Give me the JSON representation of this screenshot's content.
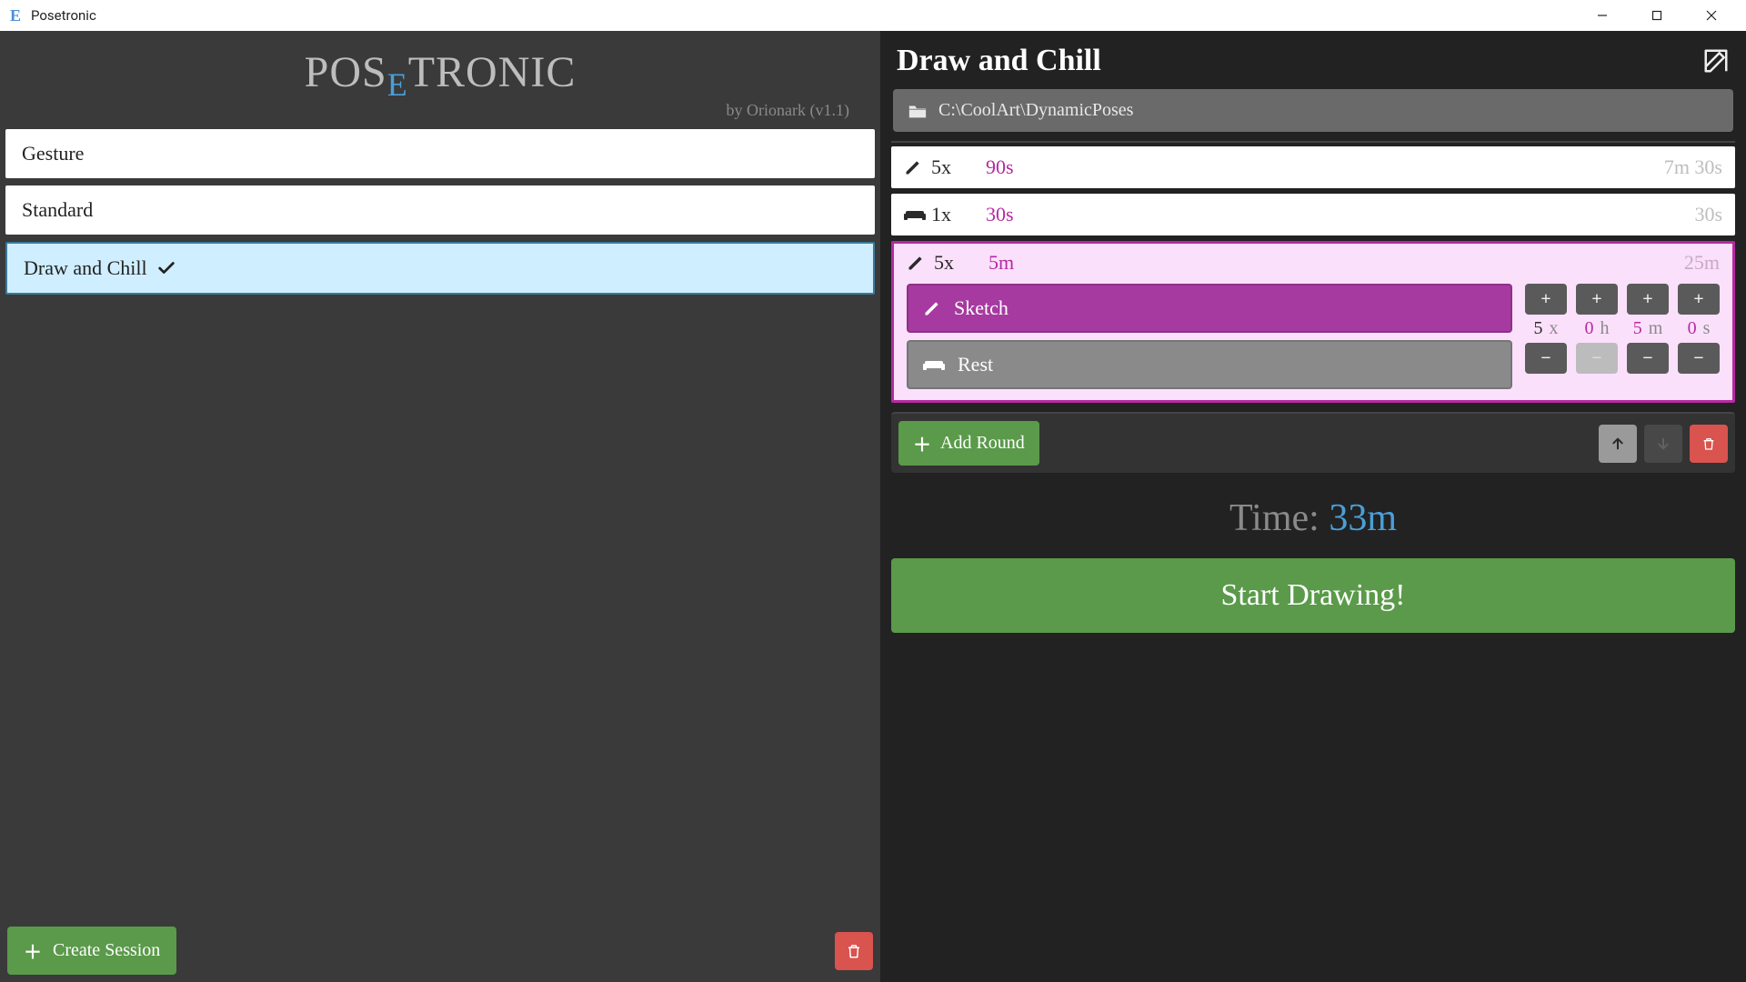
{
  "window": {
    "title": "Posetronic",
    "icon_letter": "E"
  },
  "logo": {
    "part1": "POS",
    "e": "E",
    "part2": "TRONIC",
    "byline": "by Orionark (v1.1)"
  },
  "sessions": [
    {
      "label": "Gesture",
      "selected": false
    },
    {
      "label": "Standard",
      "selected": false
    },
    {
      "label": "Draw and Chill",
      "selected": true
    }
  ],
  "left_bottom": {
    "create_label": "Create Session"
  },
  "right": {
    "title": "Draw and Chill",
    "folder": "C:\\CoolArt\\DynamicPoses",
    "rounds": [
      {
        "icon": "pencil",
        "count": "5x",
        "duration": "90s",
        "total": "7m 30s",
        "selected": false,
        "expanded": false
      },
      {
        "icon": "couch",
        "count": "1x",
        "duration": "30s",
        "total": "30s",
        "selected": false,
        "expanded": false
      },
      {
        "icon": "pencil",
        "count": "5x",
        "duration": "5m",
        "total": "25m",
        "selected": true,
        "expanded": true
      }
    ],
    "editor": {
      "modes": [
        {
          "name": "Sketch",
          "icon": "pencil",
          "active": true
        },
        {
          "name": "Rest",
          "icon": "couch",
          "active": false
        }
      ],
      "steppers": {
        "count": {
          "value": "5",
          "unit": "x"
        },
        "hours": {
          "value": "0",
          "unit": "h"
        },
        "minutes": {
          "value": "5",
          "unit": "m"
        },
        "seconds": {
          "value": "0",
          "unit": "s"
        }
      }
    },
    "add_round_label": "Add Round",
    "total_label": "Time: ",
    "total_value": "33m",
    "start_label": "Start Drawing!"
  }
}
